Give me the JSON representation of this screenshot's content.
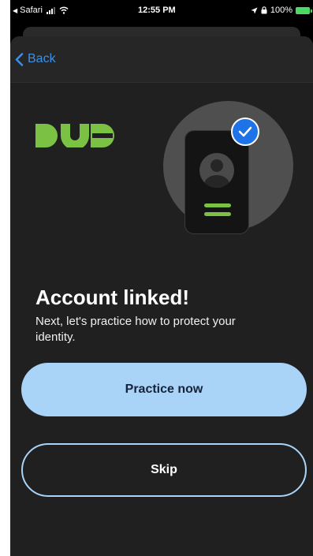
{
  "status_bar": {
    "carrier": "Safari",
    "time": "12:55 PM",
    "battery": "100%"
  },
  "nav": {
    "back_label": "Back"
  },
  "main": {
    "title": "Account linked!",
    "subtitle": "Next, let's practice how to protect your identity."
  },
  "buttons": {
    "primary_label": "Practice now",
    "secondary_label": "Skip"
  },
  "colors": {
    "accent": "#3b91e8",
    "primary_button": "#a9d3f7",
    "brand_green": "#7ac144",
    "check_blue": "#1e73e8",
    "background": "#202020"
  },
  "icons": {
    "back": "chevron-left-icon",
    "logo": "duo-logo",
    "check": "checkmark-icon",
    "location": "location-arrow-icon",
    "wifi": "wifi-icon"
  }
}
